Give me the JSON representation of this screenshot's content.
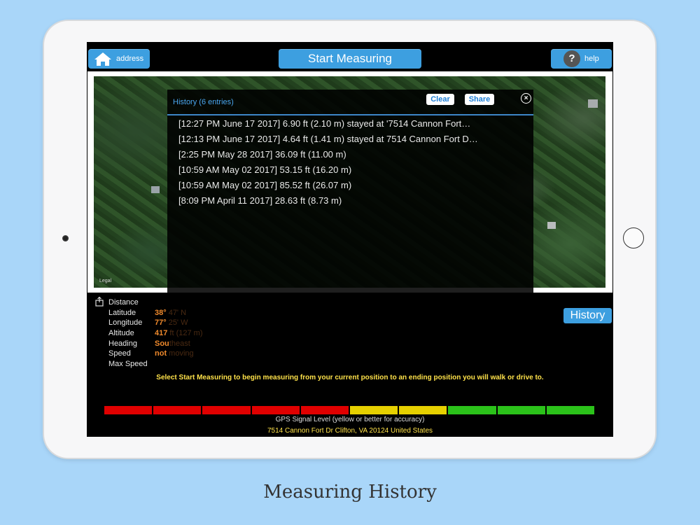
{
  "toolbar": {
    "address_label": "address",
    "start_label": "Start Measuring",
    "help_label": "help",
    "help_glyph": "?"
  },
  "map": {
    "legal_label": "Legal"
  },
  "history": {
    "title": "History (6 entries)",
    "clear_label": "Clear",
    "share_label": "Share",
    "close_glyph": "×",
    "entries": [
      "[12:27 PM June 17 2017]  6.90 ft (2.10 m)  stayed at '7514 Cannon Fort…",
      "[12:13 PM June 17 2017]  4.64 ft (1.41 m)  stayed at 7514 Cannon Fort D…",
      "[2:25 PM May 28 2017]  36.09 ft (11.00 m)",
      "[10:59 AM May 02 2017]  53.15 ft (16.20 m)",
      "[10:59 AM May 02 2017]  85.52 ft (26.07 m)",
      "[8:09 PM April 11 2017]  28.63 ft (8.73 m)"
    ]
  },
  "stats": {
    "labels": [
      "Distance",
      "Latitude",
      "Longitude",
      "Altitude",
      "Heading",
      "Speed",
      "Max Speed"
    ],
    "latitude_main": "38°",
    "latitude_rest": " 47' N",
    "longitude_main": "77°",
    "longitude_rest": " 25' W",
    "altitude_main": "417",
    "altitude_rest": " ft (127 m)",
    "heading_main": "Sou",
    "heading_rest": "theast",
    "speed_main": "not",
    "speed_rest": " moving"
  },
  "history_button_label": "History",
  "instructions": "Select Start Measuring to begin measuring from your current position to an ending position you will walk or drive to.",
  "gps": {
    "label": "GPS Signal Level (yellow or better for accuracy)",
    "segments": [
      "#e00000",
      "#e00000",
      "#e00000",
      "#e00000",
      "#e00000",
      "#e6d000",
      "#e6d000",
      "#2bc21a",
      "#2bc21a",
      "#2bc21a"
    ]
  },
  "location": "7514 Cannon Fort Dr Clifton, VA 20124 United States",
  "caption": "Measuring History"
}
